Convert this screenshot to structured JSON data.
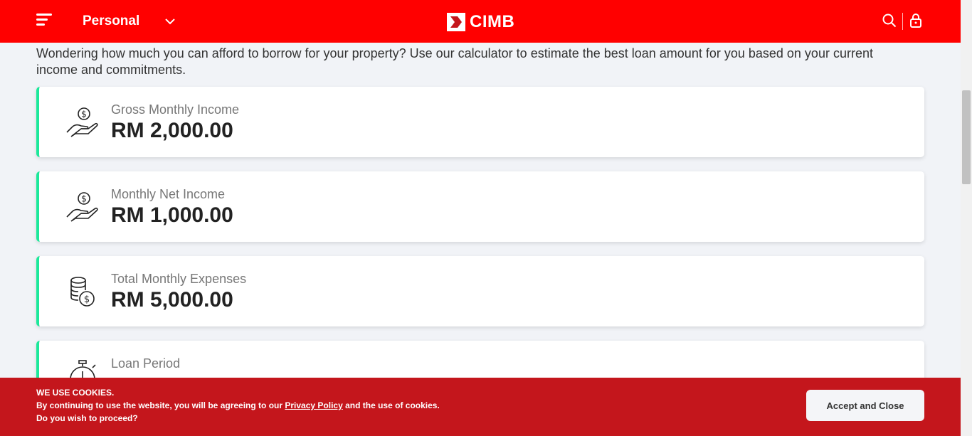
{
  "header": {
    "segment_label": "Personal",
    "logo_text": "CIMB",
    "brand_color": "#ff0000"
  },
  "intro": "Wondering how much you can afford to borrow for your property? Use our calculator to estimate the best loan amount for you based on your current income and commitments.",
  "cards": [
    {
      "label": "Gross Monthly Income",
      "value": "RM 2,000.00",
      "icon": "hand-coin-icon"
    },
    {
      "label": "Monthly Net Income",
      "value": "RM 1,000.00",
      "icon": "hand-coin-icon"
    },
    {
      "label": "Total Monthly Expenses",
      "value": "RM 5,000.00",
      "icon": "coin-stack-icon"
    },
    {
      "label": "Loan Period",
      "value": "",
      "icon": "stopwatch-icon"
    }
  ],
  "cookie": {
    "title": "WE USE COOKIES.",
    "line_before": "By continuing to use the website, you will be agreeing to our ",
    "link_text": "Privacy Policy",
    "line_after": " and the use of cookies.",
    "question": "Do you wish to proceed?",
    "button_label": "Accept and Close",
    "banner_color": "#c4161c"
  },
  "accent_color": "#1de89b"
}
